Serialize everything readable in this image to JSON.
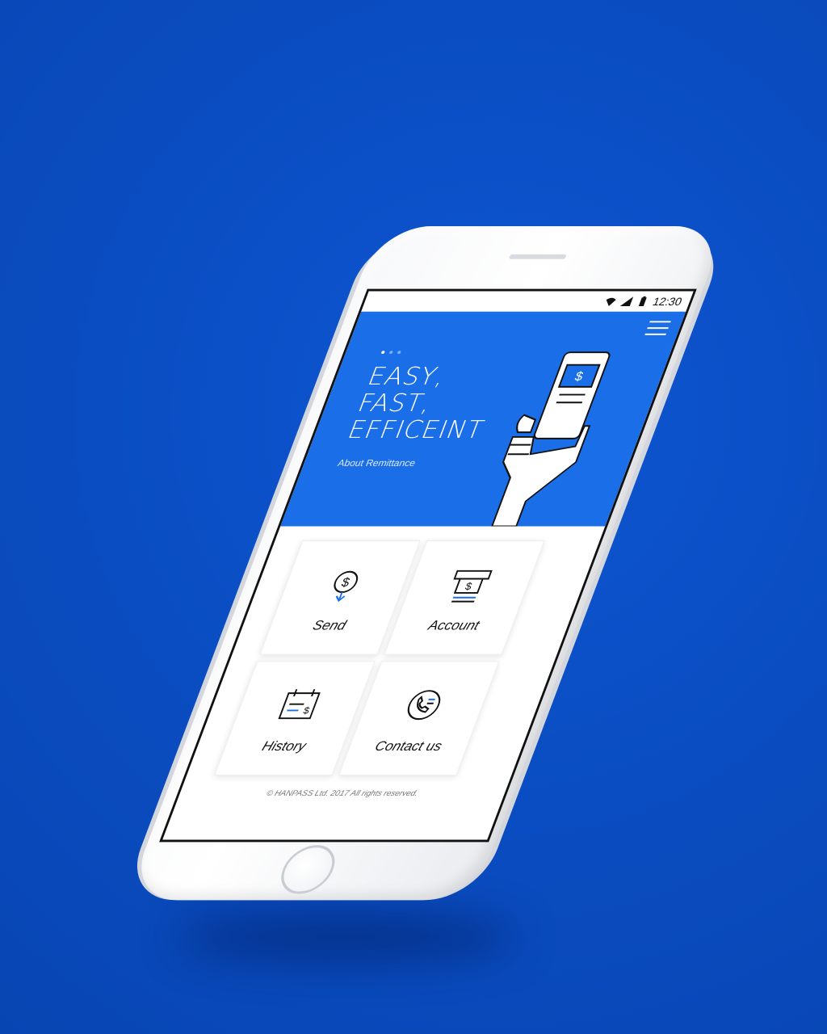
{
  "colors": {
    "background": "#0a4ec4",
    "accent": "#1a6ee8",
    "tile_background": "#ffffff",
    "icon_line": "#111111",
    "icon_accent": "#1a6ee8"
  },
  "status_bar": {
    "time": "12:30",
    "icons": [
      "wifi-icon",
      "signal-icon",
      "battery-icon"
    ]
  },
  "header": {
    "menu_icon": "hamburger-menu-icon"
  },
  "hero": {
    "slide_count": 3,
    "active_slide": 1,
    "title_lines": [
      "EASY,",
      "FAST,",
      "EFFICEINT"
    ],
    "link_label": "About Remittance",
    "illustration": "hand-holding-phone-dollar-icon"
  },
  "tiles": [
    {
      "label": "Send",
      "icon": "send-money-icon"
    },
    {
      "label": "Account",
      "icon": "account-atm-icon"
    },
    {
      "label": "History",
      "icon": "history-calendar-icon"
    },
    {
      "label": "Contact us",
      "icon": "contact-phone-icon"
    }
  ],
  "footer": {
    "copyright": "© HANPASS Ltd. 2017 All rights reserved."
  }
}
